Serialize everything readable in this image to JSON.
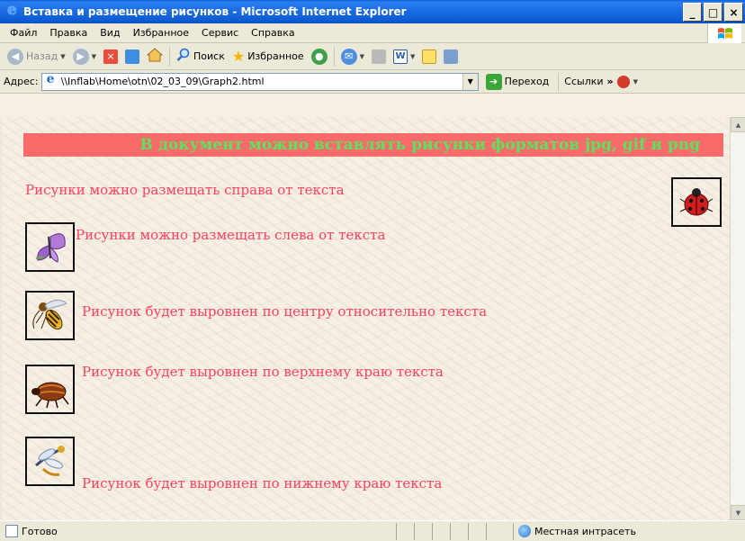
{
  "window": {
    "title": "Вставка и размещение рисунков - Microsoft Internet Explorer",
    "minimize": "_",
    "maximize": "□",
    "close": "×"
  },
  "menu": {
    "items": [
      "Файл",
      "Правка",
      "Вид",
      "Избранное",
      "Сервис",
      "Справка"
    ]
  },
  "toolbar": {
    "back": "Назад",
    "search": "Поиск",
    "favorites": "Избранное"
  },
  "address": {
    "label": "Адрес:",
    "url": "\\\\Inflab\\Home\\otn\\02_03_09\\Graph2.html",
    "go": "Переход",
    "links": "Ссылки"
  },
  "page": {
    "heading": "В документ можно вставлять рисунки форматов jpg, gif и png",
    "lines": [
      "Рисунки можно размещать справа от текста",
      "Рисунки можно размещать слева от текста",
      "Рисунок будет выровнен по центру относительно текста",
      "Рисунок будет выровнен по верхнему краю текста",
      "Рисунок будет выровнен по нижнему краю текста"
    ],
    "colors": {
      "heading_bg": "#f96a6a",
      "heading_text": "#5be25f",
      "body_text": "#ff3f5f"
    }
  },
  "status": {
    "text": "Готово",
    "zone": "Местная интрасеть"
  }
}
